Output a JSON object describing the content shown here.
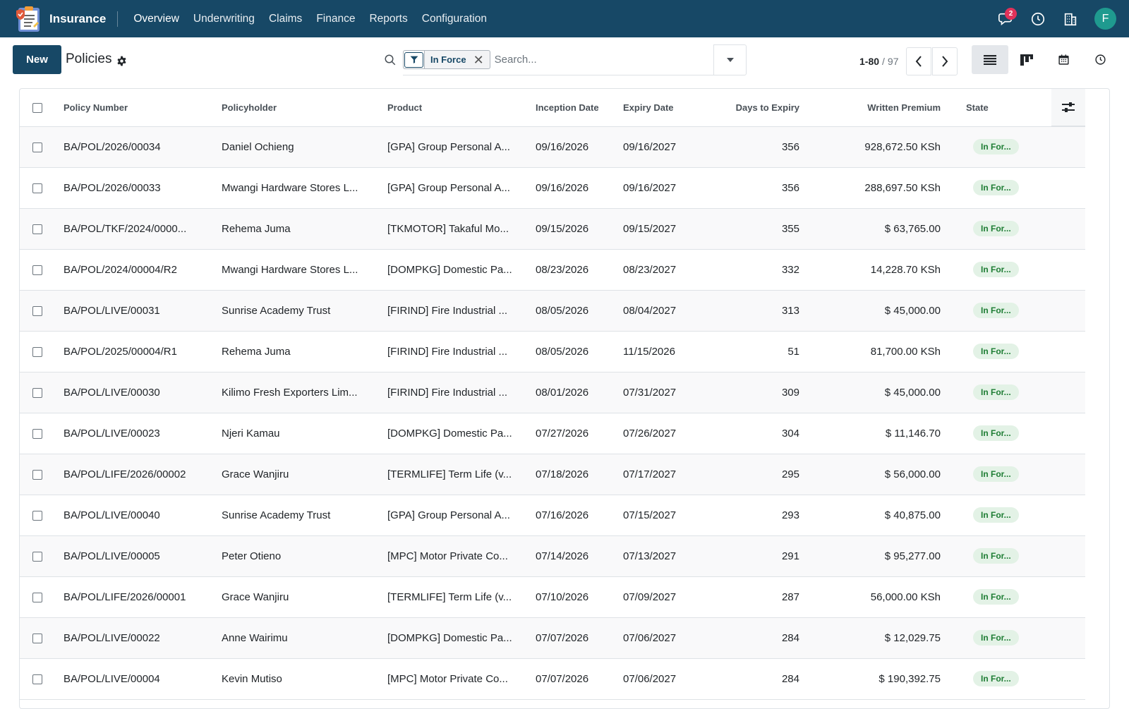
{
  "navbar": {
    "app_name": "Insurance",
    "menu": [
      {
        "label": "Overview"
      },
      {
        "label": "Underwriting"
      },
      {
        "label": "Claims"
      },
      {
        "label": "Finance"
      },
      {
        "label": "Reports"
      },
      {
        "label": "Configuration"
      }
    ],
    "messages_badge": "2",
    "avatar_initial": "F",
    "colors": {
      "bar": "#174866",
      "avatar": "#1f9a8f",
      "badge": "#e0325a"
    }
  },
  "control": {
    "new_label": "New",
    "title": "Policies",
    "facet_value": "In Force",
    "search_placeholder": "Search...",
    "pager": {
      "value": "1-80",
      "separator": "/",
      "total": "97"
    }
  },
  "table": {
    "headers": {
      "policy_number": "Policy Number",
      "policyholder": "Policyholder",
      "product": "Product",
      "inception": "Inception Date",
      "expiry": "Expiry Date",
      "days": "Days to Expiry",
      "premium": "Written Premium",
      "state": "State"
    },
    "rows": [
      {
        "policy_number": "BA/POL/2026/00034",
        "policyholder": "Daniel Ochieng",
        "product": "[GPA] Group Personal A...",
        "inception": "09/16/2026",
        "expiry": "09/16/2027",
        "days": "356",
        "premium": "928,672.50 KSh",
        "state": "In For..."
      },
      {
        "policy_number": "BA/POL/2026/00033",
        "policyholder": "Mwangi Hardware Stores L...",
        "product": "[GPA] Group Personal A...",
        "inception": "09/16/2026",
        "expiry": "09/16/2027",
        "days": "356",
        "premium": "288,697.50 KSh",
        "state": "In For..."
      },
      {
        "policy_number": "BA/POL/TKF/2024/0000...",
        "policyholder": "Rehema Juma",
        "product": "[TKMOTOR] Takaful Mo...",
        "inception": "09/15/2026",
        "expiry": "09/15/2027",
        "days": "355",
        "premium": "$ 63,765.00",
        "state": "In For..."
      },
      {
        "policy_number": "BA/POL/2024/00004/R2",
        "policyholder": "Mwangi Hardware Stores L...",
        "product": "[DOMPKG] Domestic Pa...",
        "inception": "08/23/2026",
        "expiry": "08/23/2027",
        "days": "332",
        "premium": "14,228.70 KSh",
        "state": "In For..."
      },
      {
        "policy_number": "BA/POL/LIVE/00031",
        "policyholder": "Sunrise Academy Trust",
        "product": "[FIRIND] Fire Industrial ...",
        "inception": "08/05/2026",
        "expiry": "08/04/2027",
        "days": "313",
        "premium": "$ 45,000.00",
        "state": "In For..."
      },
      {
        "policy_number": "BA/POL/2025/00004/R1",
        "policyholder": "Rehema Juma",
        "product": "[FIRIND] Fire Industrial ...",
        "inception": "08/05/2026",
        "expiry": "11/15/2026",
        "days": "51",
        "premium": "81,700.00 KSh",
        "state": "In For..."
      },
      {
        "policy_number": "BA/POL/LIVE/00030",
        "policyholder": "Kilimo Fresh Exporters Lim...",
        "product": "[FIRIND] Fire Industrial ...",
        "inception": "08/01/2026",
        "expiry": "07/31/2027",
        "days": "309",
        "premium": "$ 45,000.00",
        "state": "In For..."
      },
      {
        "policy_number": "BA/POL/LIVE/00023",
        "policyholder": "Njeri Kamau",
        "product": "[DOMPKG] Domestic Pa...",
        "inception": "07/27/2026",
        "expiry": "07/26/2027",
        "days": "304",
        "premium": "$ 11,146.70",
        "state": "In For..."
      },
      {
        "policy_number": "BA/POL/LIFE/2026/00002",
        "policyholder": "Grace Wanjiru",
        "product": "[TERMLIFE] Term Life (v...",
        "inception": "07/18/2026",
        "expiry": "07/17/2027",
        "days": "295",
        "premium": "$ 56,000.00",
        "state": "In For..."
      },
      {
        "policy_number": "BA/POL/LIVE/00040",
        "policyholder": "Sunrise Academy Trust",
        "product": "[GPA] Group Personal A...",
        "inception": "07/16/2026",
        "expiry": "07/15/2027",
        "days": "293",
        "premium": "$ 40,875.00",
        "state": "In For..."
      },
      {
        "policy_number": "BA/POL/LIVE/00005",
        "policyholder": "Peter Otieno",
        "product": "[MPC] Motor Private Co...",
        "inception": "07/14/2026",
        "expiry": "07/13/2027",
        "days": "291",
        "premium": "$ 95,277.00",
        "state": "In For..."
      },
      {
        "policy_number": "BA/POL/LIFE/2026/00001",
        "policyholder": "Grace Wanjiru",
        "product": "[TERMLIFE] Term Life (v...",
        "inception": "07/10/2026",
        "expiry": "07/09/2027",
        "days": "287",
        "premium": "56,000.00 KSh",
        "state": "In For..."
      },
      {
        "policy_number": "BA/POL/LIVE/00022",
        "policyholder": "Anne Wairimu",
        "product": "[DOMPKG] Domestic Pa...",
        "inception": "07/07/2026",
        "expiry": "07/06/2027",
        "days": "284",
        "premium": "$ 12,029.75",
        "state": "In For..."
      },
      {
        "policy_number": "BA/POL/LIVE/00004",
        "policyholder": "Kevin Mutiso",
        "product": "[MPC] Motor Private Co...",
        "inception": "07/07/2026",
        "expiry": "07/06/2027",
        "days": "284",
        "premium": "$ 190,392.75",
        "state": "In For..."
      }
    ]
  }
}
